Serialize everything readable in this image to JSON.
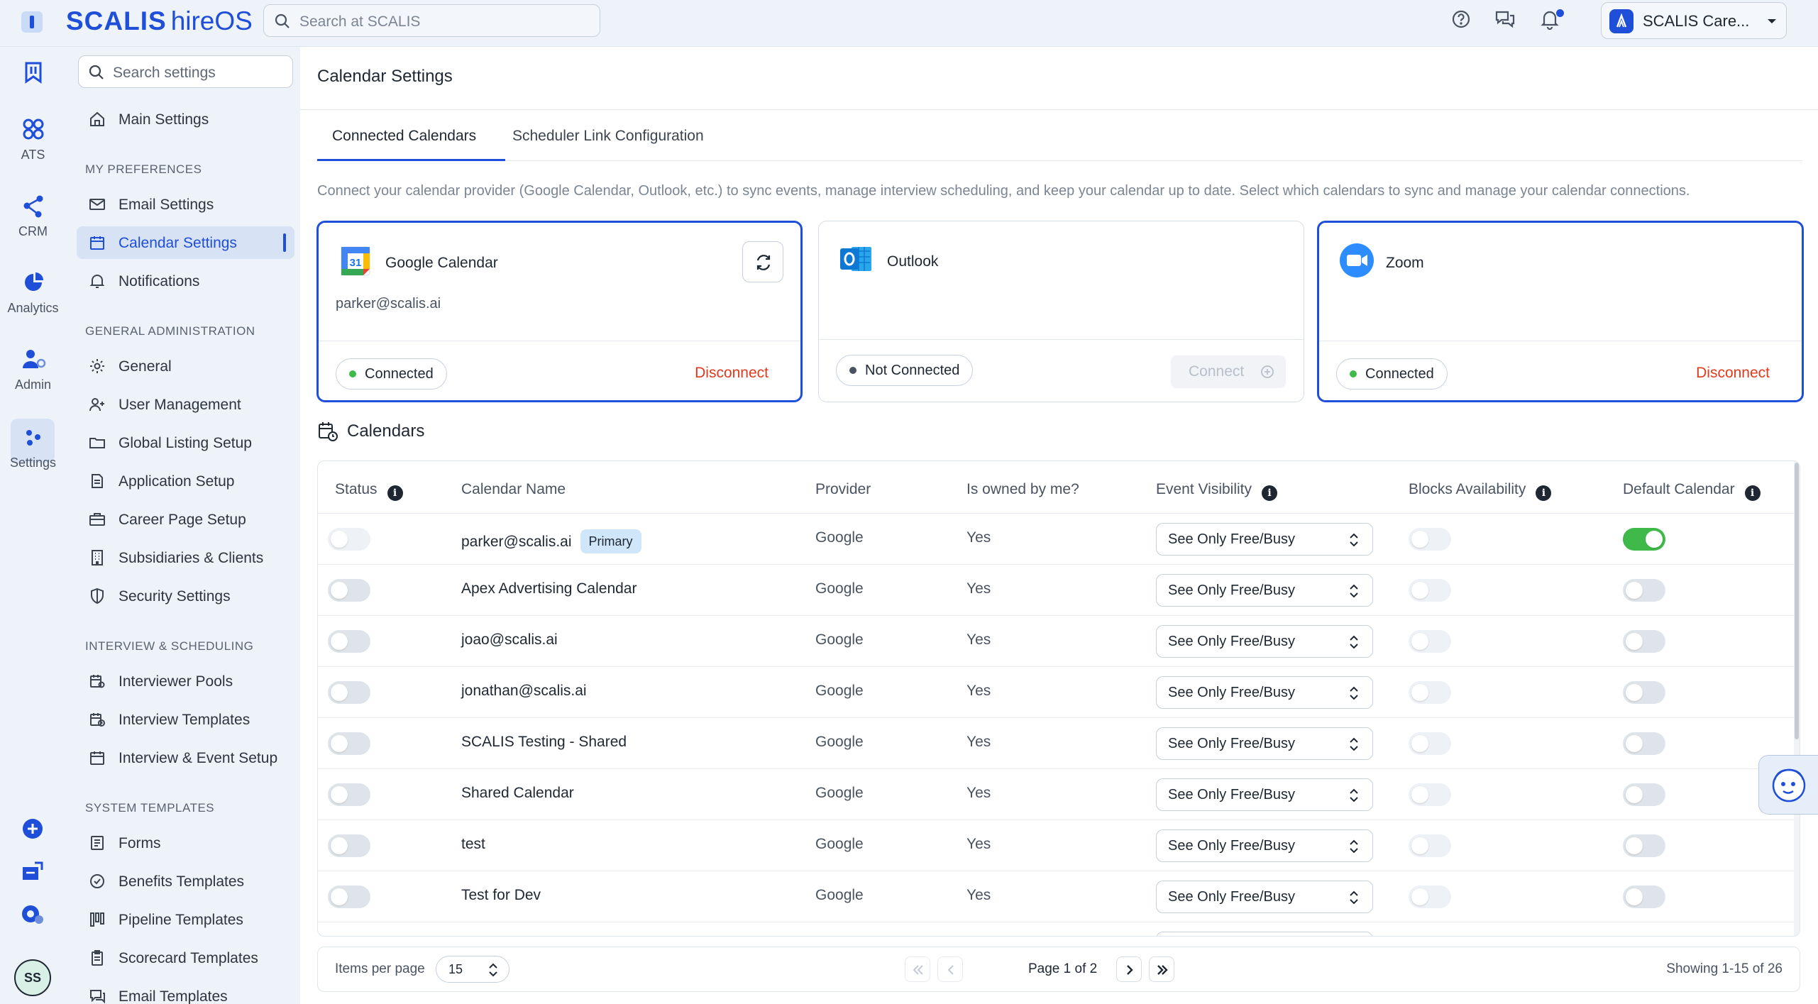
{
  "app": {
    "brand_main": "SCALIS",
    "brand_sub": "hireOS",
    "search_placeholder": "Search at SCALIS",
    "account_name": "SCALIS Care..."
  },
  "rail": {
    "items": [
      {
        "label": ""
      },
      {
        "label": "ATS"
      },
      {
        "label": "CRM"
      },
      {
        "label": "Analytics"
      },
      {
        "label": "Admin"
      },
      {
        "label": "Settings"
      }
    ],
    "avatar_initials": "SS"
  },
  "sidebar": {
    "search_placeholder": "Search settings",
    "main_settings": "Main Settings",
    "sections": [
      {
        "heading": "MY PREFERENCES",
        "items": [
          "Email Settings",
          "Calendar Settings",
          "Notifications"
        ]
      },
      {
        "heading": "GENERAL ADMINISTRATION",
        "items": [
          "General",
          "User Management",
          "Global Listing Setup",
          "Application Setup",
          "Career Page Setup",
          "Subsidiaries & Clients",
          "Security Settings"
        ]
      },
      {
        "heading": "INTERVIEW & SCHEDULING",
        "items": [
          "Interviewer Pools",
          "Interview Templates",
          "Interview & Event Setup"
        ]
      },
      {
        "heading": "SYSTEM TEMPLATES",
        "items": [
          "Forms",
          "Benefits Templates",
          "Pipeline Templates",
          "Scorecard Templates",
          "Email Templates"
        ]
      }
    ],
    "active_item": "Calendar Settings"
  },
  "main": {
    "title": "Calendar Settings",
    "tabs": [
      {
        "label": "Connected Calendars",
        "active": true
      },
      {
        "label": "Scheduler Link Configuration",
        "active": false
      }
    ],
    "intro": "Connect your calendar provider (Google Calendar, Outlook, etc.) to sync events, manage interview scheduling, and keep your calendar up to date. Select which calendars to sync and manage your calendar connections.",
    "providers": [
      {
        "name": "Google Calendar",
        "email": "parker@scalis.ai",
        "status": "Connected",
        "action": "Disconnect",
        "selected": true
      },
      {
        "name": "Outlook",
        "email": "",
        "status": "Not Connected",
        "action": "Connect",
        "selected": false
      },
      {
        "name": "Zoom",
        "email": "",
        "status": "Connected",
        "action": "Disconnect",
        "selected": true
      }
    ],
    "calendars_heading": "Calendars",
    "table": {
      "headers": [
        "Status",
        "Calendar Name",
        "Provider",
        "Is owned by me?",
        "Event Visibility",
        "Blocks Availability",
        "Default Calendar"
      ],
      "primary_badge": "Primary",
      "rows": [
        {
          "name": "parker@scalis.ai",
          "primary": true,
          "provider": "Google",
          "owned": "Yes",
          "visibility": "See Only Free/Busy",
          "status_on": false,
          "blocks": false,
          "default": true
        },
        {
          "name": "Apex Advertising Calendar",
          "primary": false,
          "provider": "Google",
          "owned": "Yes",
          "visibility": "See Only Free/Busy",
          "status_on": false,
          "blocks": false,
          "default": false
        },
        {
          "name": "joao@scalis.ai",
          "primary": false,
          "provider": "Google",
          "owned": "Yes",
          "visibility": "See Only Free/Busy",
          "status_on": false,
          "blocks": false,
          "default": false
        },
        {
          "name": "jonathan@scalis.ai",
          "primary": false,
          "provider": "Google",
          "owned": "Yes",
          "visibility": "See Only Free/Busy",
          "status_on": false,
          "blocks": false,
          "default": false
        },
        {
          "name": "SCALIS Testing - Shared",
          "primary": false,
          "provider": "Google",
          "owned": "Yes",
          "visibility": "See Only Free/Busy",
          "status_on": false,
          "blocks": false,
          "default": false
        },
        {
          "name": "Shared Calendar",
          "primary": false,
          "provider": "Google",
          "owned": "Yes",
          "visibility": "See Only Free/Busy",
          "status_on": false,
          "blocks": false,
          "default": false
        },
        {
          "name": "test",
          "primary": false,
          "provider": "Google",
          "owned": "Yes",
          "visibility": "See Only Free/Busy",
          "status_on": false,
          "blocks": false,
          "default": false
        },
        {
          "name": "Test for Dev",
          "primary": false,
          "provider": "Google",
          "owned": "Yes",
          "visibility": "See Only Free/Busy",
          "status_on": false,
          "blocks": false,
          "default": false
        }
      ]
    },
    "pagination": {
      "items_per_page_label": "Items per page",
      "items_per_page": "15",
      "page_text": "Page 1 of 2",
      "showing": "Showing 1-15 of 26"
    }
  },
  "colors": {
    "accent": "#1f4ed8",
    "danger": "#e03a1e",
    "success": "#3fba4a"
  }
}
